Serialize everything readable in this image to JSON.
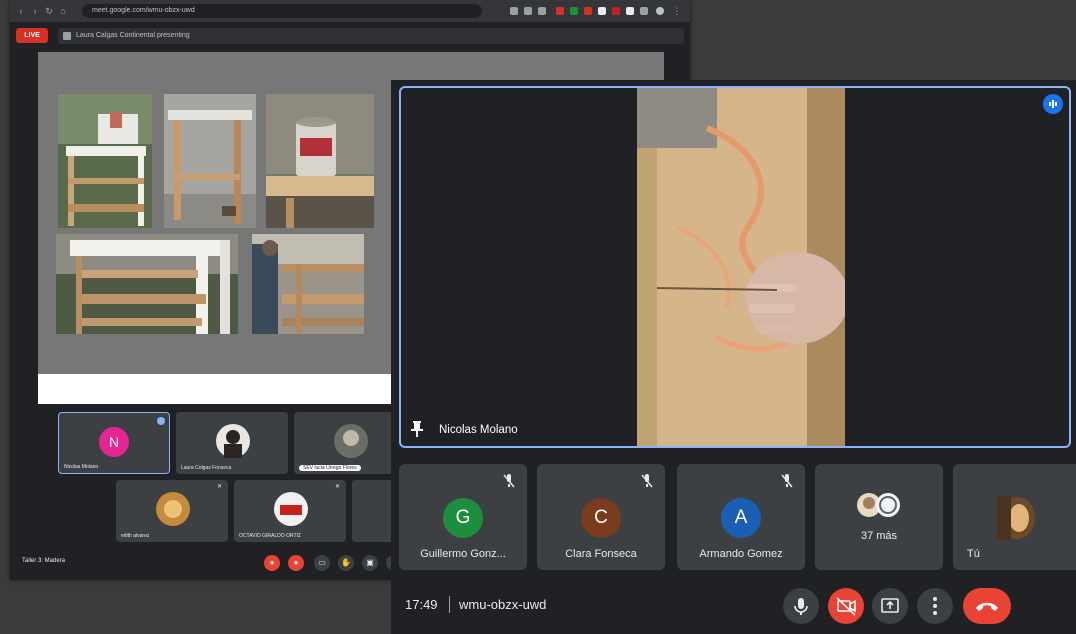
{
  "left_window": {
    "url": "meet.google.com/wmu-obzx-uwd",
    "live_label": "LIVE",
    "presenting_label": "Laura Calgas Continental presenting",
    "thumbnails": [
      {
        "label": "Nicolas Molano",
        "initial": "N",
        "color": "#e52592"
      },
      {
        "label": "Laura Colgas Fonseca",
        "initial": "",
        "color": ""
      },
      {
        "label": "SEV lucia Urrego Flores",
        "initial": "",
        "color": ""
      },
      {
        "label": "edith alvarez",
        "initial": "",
        "color": ""
      },
      {
        "label": "OCTAVIO GIRALDO ORTIZ",
        "initial": "",
        "color": ""
      }
    ],
    "meeting_name": "Taller 3: Madera"
  },
  "main_tile": {
    "speaker_name": "Nicolas Molano",
    "active_speaker_color": "#8ab4f8"
  },
  "participants": [
    {
      "name": "Guillermo Gonz...",
      "initial": "G",
      "color": "#1e8e3e",
      "muted": true,
      "icon": "mic-off-icon"
    },
    {
      "name": "Clara Fonseca",
      "initial": "C",
      "color": "#7a3b1e",
      "muted": true,
      "icon": "mic-off-icon"
    },
    {
      "name": "Armando Gomez",
      "initial": "A",
      "color": "#1a5fb4",
      "muted": true,
      "icon": "mic-off-icon"
    },
    {
      "name": "37 más",
      "initial": "",
      "color": "",
      "muted": false,
      "icon": "more-participants-avatars"
    },
    {
      "name": "Tú",
      "initial": "",
      "color": "",
      "muted": false,
      "icon": "self-video"
    }
  ],
  "bottom_bar": {
    "time": "17:49",
    "meeting_code": "wmu-obzx-uwd",
    "controls": [
      {
        "name": "microphone-button",
        "icon": "mic-icon"
      },
      {
        "name": "camera-off-button",
        "icon": "camera-off-icon",
        "color": "#ea4335"
      },
      {
        "name": "present-button",
        "icon": "present-icon"
      },
      {
        "name": "more-options-button",
        "icon": "more-vert-icon"
      },
      {
        "name": "end-call-button",
        "icon": "call-end-icon",
        "color": "#ea4335"
      }
    ]
  }
}
